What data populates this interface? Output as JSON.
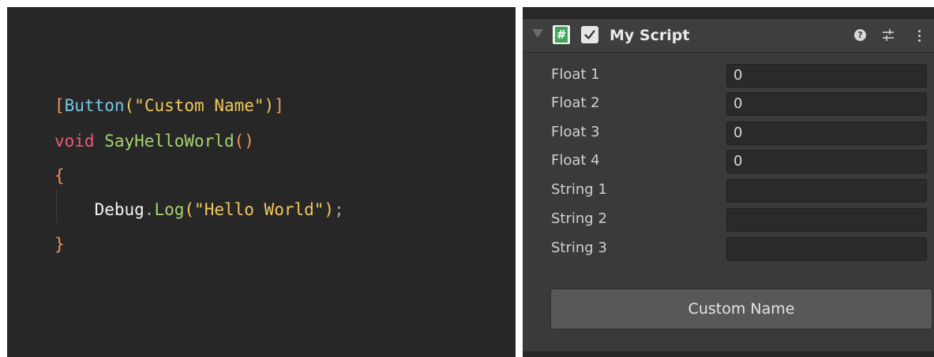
{
  "code": {
    "line1": {
      "open_bracket": "[",
      "attribute": "Button",
      "paren_open": "(",
      "string": "\"Custom Name\"",
      "paren_close": ")",
      "close_bracket": "]"
    },
    "line2": {
      "keyword": "void",
      "space": " ",
      "method": "SayHelloWorld",
      "parens": "()"
    },
    "line3": {
      "brace": "{"
    },
    "line4": {
      "indent": "    ",
      "class": "Debug",
      "dot": ".",
      "method": "Log",
      "paren_open": "(",
      "string": "\"Hello World\"",
      "paren_close": ")",
      "semicolon": ";"
    },
    "line5": {
      "brace": "}"
    }
  },
  "inspector": {
    "component_title": "My Script",
    "enabled": true,
    "script_icon_glyph": "#",
    "help_icon_glyph": "?",
    "fields": [
      {
        "label": "Float 1",
        "value": "0"
      },
      {
        "label": "Float 2",
        "value": "0"
      },
      {
        "label": "Float 3",
        "value": "0"
      },
      {
        "label": "Float 4",
        "value": "0"
      },
      {
        "label": "String 1",
        "value": ""
      },
      {
        "label": "String 2",
        "value": ""
      },
      {
        "label": "String 3",
        "value": ""
      }
    ],
    "button_label": "Custom Name",
    "icons": [
      "fold-arrow-icon",
      "csharp-script-icon",
      "checkbox-icon",
      "help-icon",
      "presets-icon",
      "more-menu-icon"
    ]
  },
  "colors": {
    "code_background": "#272728",
    "inspector_background": "#3a3a3a",
    "attribute": "#78c6e0",
    "string": "#f1c85f",
    "keyword": "#e85a79",
    "method": "#a6d36f",
    "bracket": "#f2935a"
  }
}
